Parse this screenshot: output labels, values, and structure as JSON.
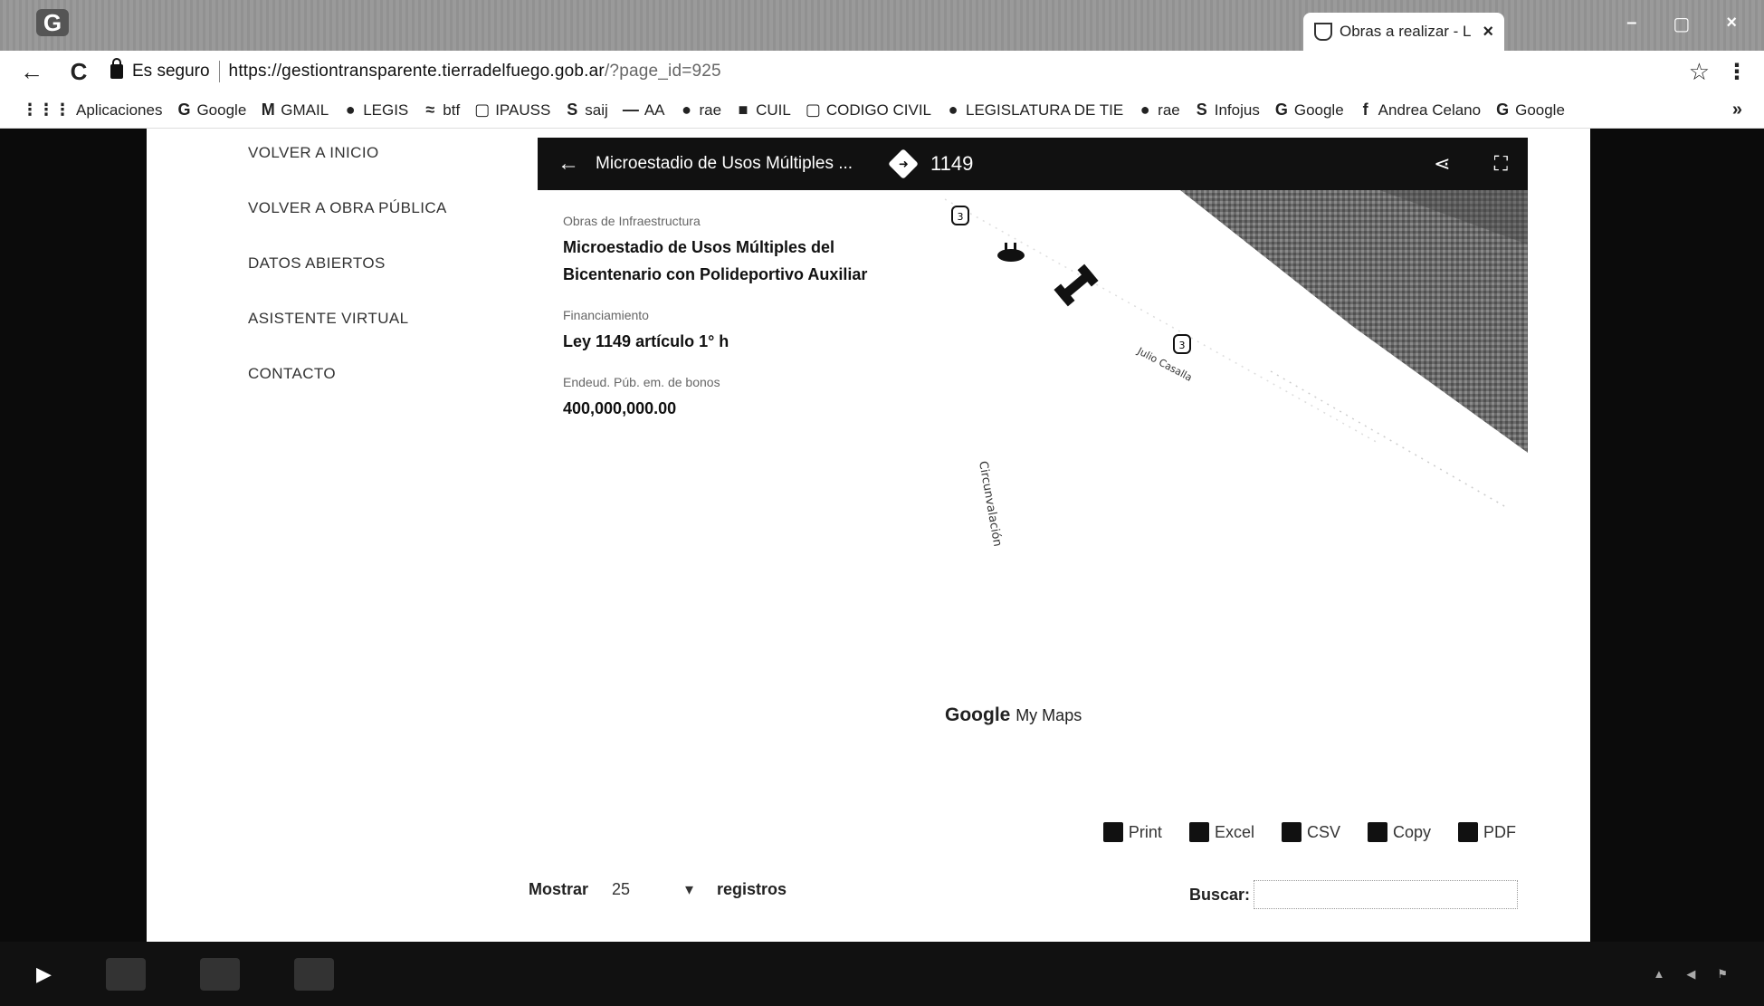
{
  "browser": {
    "tab_title": "Obras a realizar - L",
    "tab_close": "×",
    "window_controls": [
      "–",
      "▢",
      "×"
    ],
    "secure_label": "Es seguro",
    "url_host": "https://gestiontransparente.tierradelfuego.gob.ar",
    "url_path": "/?page_id=925",
    "bookmarks": [
      {
        "icon": "⋮⋮⋮",
        "label": "Aplicaciones"
      },
      {
        "icon": "G",
        "label": "Google"
      },
      {
        "icon": "M",
        "label": "GMAIL"
      },
      {
        "icon": "●",
        "label": "LEGIS"
      },
      {
        "icon": "≈",
        "label": "btf"
      },
      {
        "icon": "▢",
        "label": "IPAUSS"
      },
      {
        "icon": "S",
        "label": "saij"
      },
      {
        "icon": "—",
        "label": "AA"
      },
      {
        "icon": "●",
        "label": "rae"
      },
      {
        "icon": "■",
        "label": "CUIL"
      },
      {
        "icon": "▢",
        "label": "CODIGO CIVIL"
      },
      {
        "icon": "●",
        "label": "LEGISLATURA DE TIE"
      },
      {
        "icon": "●",
        "label": "rae"
      },
      {
        "icon": "S",
        "label": "Infojus"
      },
      {
        "icon": "G",
        "label": "Google"
      },
      {
        "icon": "f",
        "label": "Andrea Celano"
      },
      {
        "icon": "G",
        "label": "Google"
      }
    ],
    "bookmarks_more": "»"
  },
  "menu": [
    "VOLVER A INICIO",
    "VOLVER A OBRA PÚBLICA",
    "DATOS ABIERTOS",
    "ASISTENTE VIRTUAL",
    "CONTACTO"
  ],
  "map": {
    "title": "Microestadio de Usos Múltiples ...",
    "number": "1149",
    "info": [
      {
        "label": "Obras de Infraestructura",
        "value": "Microestadio de Usos Múltiples del Bicentenario con Polideportivo Auxiliar"
      },
      {
        "label": "Financiamiento",
        "value": "Ley 1149 artículo 1° h"
      },
      {
        "label": "Endeud. Púb. em. de bonos",
        "value": "400,000,000.00"
      }
    ],
    "street_1": "Circunvalación",
    "street_2": "Julio Casalla",
    "route_badge": "3",
    "brand_google": "Google",
    "brand_mymaps": "My Maps"
  },
  "table": {
    "buttons": [
      "Print",
      "Excel",
      "CSV",
      "Copy",
      "PDF"
    ],
    "show_label": "Mostrar",
    "show_value": "25",
    "records_label": "registros",
    "search_label": "Buscar:",
    "search_value": ""
  }
}
